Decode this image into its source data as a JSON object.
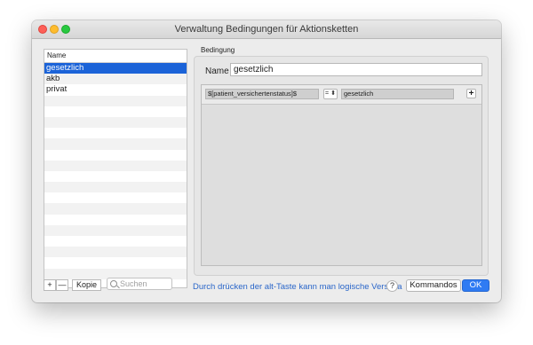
{
  "window": {
    "title": "Verwaltung Bedingungen für Aktionsketten"
  },
  "list": {
    "header": "Name",
    "items": [
      "gesetzlich",
      "akb",
      "privat"
    ],
    "selected_index": 0,
    "add_label": "+",
    "remove_label": "—",
    "copy_label": "Kopie",
    "search_placeholder": "Suchen"
  },
  "condition": {
    "group_label": "Bedingung",
    "name_label": "Name",
    "name_value": "gesetzlich",
    "rows": [
      {
        "variable": "$[patient_versichertenstatus]$",
        "operator": "=",
        "value": "gesetzlich"
      }
    ],
    "add_row_label": "+"
  },
  "footer": {
    "hint": "Durch drücken der alt-Taste kann man logische Verscha",
    "help_label": "?",
    "commands_label": "Kommandos",
    "ok_label": "OK"
  },
  "colors": {
    "selection": "#1b63d8",
    "accent": "#2f7bf3",
    "hint_text": "#2a66c9"
  }
}
